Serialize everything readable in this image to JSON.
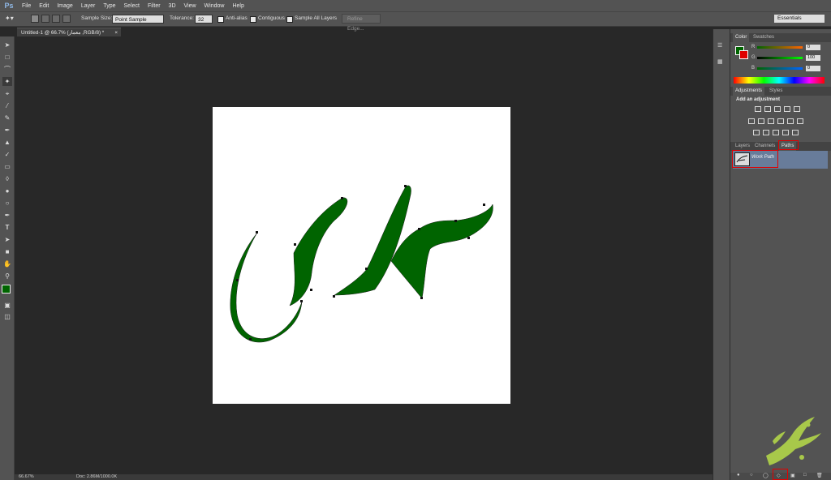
{
  "app": {
    "logo_text": "Ps"
  },
  "menu": [
    "File",
    "Edit",
    "Image",
    "Layer",
    "Type",
    "Select",
    "Filter",
    "3D",
    "View",
    "Window",
    "Help"
  ],
  "options_bar": {
    "sample_size_label": "Sample Size:",
    "sample_size_value": "Point Sample",
    "tolerance_label": "Tolerance:",
    "tolerance_value": "32",
    "anti_alias_label": "Anti-alias",
    "contiguous_label": "Contiguous",
    "sample_all_layers_label": "Sample All Layers",
    "refine_edge_label": "Refine Edge...",
    "workspace_value": "Essentials"
  },
  "document": {
    "tab_title": "Untitled-1 @ 66.7% (معمار ,RGB/8) *",
    "artwork_text": "معماری",
    "artwork_color": "#006400"
  },
  "status_bar": {
    "zoom": "66.67%",
    "doc_info": "Doc: 2.86M/1000.0K"
  },
  "color_panel": {
    "tabs": [
      "Color",
      "Swatches"
    ],
    "channels": [
      {
        "name": "R",
        "value": "0"
      },
      {
        "name": "G",
        "value": "100"
      },
      {
        "name": "B",
        "value": "0"
      }
    ],
    "foreground_color": "#006400",
    "background_color": "#e00000"
  },
  "adjustments_panel": {
    "tabs": [
      "Adjustments",
      "Styles"
    ],
    "heading": "Add an adjustment"
  },
  "layers_panel": {
    "tabs": [
      "Layers",
      "Channels",
      "Paths"
    ],
    "path_name": "Work Path"
  },
  "watermark": {
    "text": "خانه معماری"
  }
}
